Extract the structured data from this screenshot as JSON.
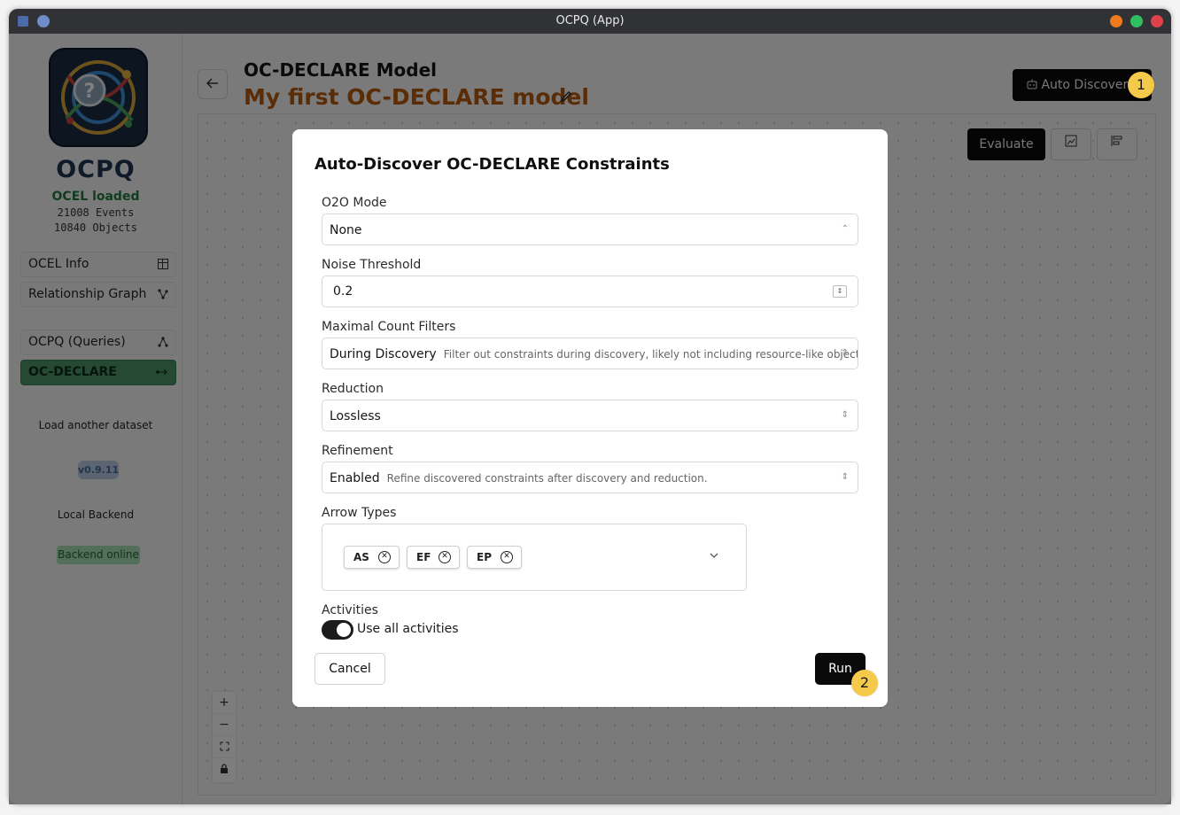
{
  "window": {
    "title": "OCPQ (App)"
  },
  "sidebar": {
    "brand": "OCPQ",
    "logo_glyph": "?",
    "ocel_status": "OCEL loaded",
    "events_count": "21008",
    "events_label": "Events",
    "objects_count": "10840",
    "objects_label": "Objects",
    "nav": [
      {
        "label": "OCEL Info",
        "icon": "table-icon"
      },
      {
        "label": "Relationship Graph",
        "icon": "graph-icon"
      },
      {
        "label": "OCPQ (Queries)",
        "icon": "query-icon"
      },
      {
        "label": "OC-DECLARE",
        "icon": "declare-icon",
        "active": true
      }
    ],
    "load_another": "Load another dataset",
    "version": "v0.9.11",
    "backend_label": "Local Backend",
    "backend_status": "Backend online"
  },
  "main": {
    "heading": "OC-DECLARE Model",
    "model_name": "My first OC-DECLARE model",
    "auto_discover_label": "Auto Discover",
    "evaluate_label": "Evaluate"
  },
  "modal": {
    "title": "Auto-Discover OC-DECLARE Constraints",
    "o2o": {
      "label": "O2O Mode",
      "value": "None"
    },
    "noise": {
      "label": "Noise Threshold",
      "value": "0.2"
    },
    "max_count": {
      "label": "Maximal Count Filters",
      "value": "During Discovery",
      "description": "Filter out constraints during discovery, likely not including resource-like object types."
    },
    "reduction": {
      "label": "Reduction",
      "value": "Lossless"
    },
    "refinement": {
      "label": "Refinement",
      "value": "Enabled",
      "description": "Refine discovered constraints after discovery and reduction."
    },
    "arrow_types": {
      "label": "Arrow Types",
      "chips": [
        "AS",
        "EF",
        "EP"
      ]
    },
    "activities": {
      "label": "Activities",
      "toggle_label": "Use all activities"
    },
    "cancel_label": "Cancel",
    "run_label": "Run"
  },
  "markers": [
    "1",
    "2"
  ],
  "colors": {
    "brand": "#1d3550",
    "model_name": "#b55a0c",
    "ocel_status": "#1f7a3d",
    "active_nav": "#4b9264",
    "marker": "#f5c94a",
    "close": "#e0424b",
    "maximize": "#2fbf5e",
    "minimize": "#f07a1f"
  }
}
